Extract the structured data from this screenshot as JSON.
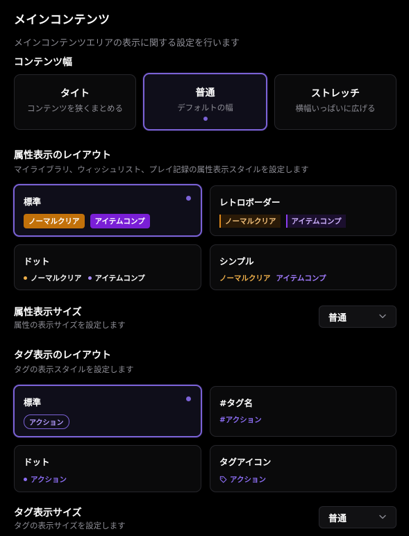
{
  "section": {
    "title": "メインコンテンツ",
    "description": "メインコンテンツエリアの表示に関する設定を行います"
  },
  "content_width": {
    "heading": "コンテンツ幅",
    "options": [
      {
        "title": "タイト",
        "desc": "コンテンツを狭くまとめる",
        "selected": false
      },
      {
        "title": "普通",
        "desc": "デフォルトの幅",
        "selected": true
      },
      {
        "title": "ストレッチ",
        "desc": "横幅いっぱいに広げる",
        "selected": false
      }
    ]
  },
  "attr_layout": {
    "heading": "属性表示のレイアウト",
    "description": "マイライブラリ、ウィッシュリスト、プレイ記録の属性表示スタイルを設定します",
    "options": [
      {
        "title": "標準",
        "badge1": "ノーマルクリア",
        "badge2": "アイテムコンプ",
        "selected": true
      },
      {
        "title": "レトロボーダー",
        "badge1": "ノーマルクリア",
        "badge2": "アイテムコンプ",
        "selected": false
      },
      {
        "title": "ドット",
        "badge1": "ノーマルクリア",
        "badge2": "アイテムコンプ",
        "selected": false
      },
      {
        "title": "シンプル",
        "badge1": "ノーマルクリア",
        "badge2": "アイテムコンプ",
        "selected": false
      }
    ]
  },
  "attr_size": {
    "heading": "属性表示サイズ",
    "description": "属性の表示サイズを設定します",
    "value": "普通"
  },
  "tag_layout": {
    "heading": "タグ表示のレイアウト",
    "description": "タグの表示スタイルを設定します",
    "options": [
      {
        "title": "標準",
        "tag": "アクション",
        "selected": true
      },
      {
        "title": "#タグ名",
        "tag": "#アクション",
        "selected": false
      },
      {
        "title": "ドット",
        "tag": "アクション",
        "selected": false
      },
      {
        "title": "タグアイコン",
        "tag": "アクション",
        "selected": false
      }
    ]
  },
  "tag_size": {
    "heading": "タグ表示サイズ",
    "description": "タグの表示サイズを設定します",
    "value": "普通"
  },
  "colors": {
    "accent": "#7b62d6",
    "normal_clear": "#c2710a",
    "item_comp": "#7a1fd6"
  },
  "icons": {
    "select_chevron": "chevron-down-icon",
    "tag_icon": "tag-icon"
  }
}
